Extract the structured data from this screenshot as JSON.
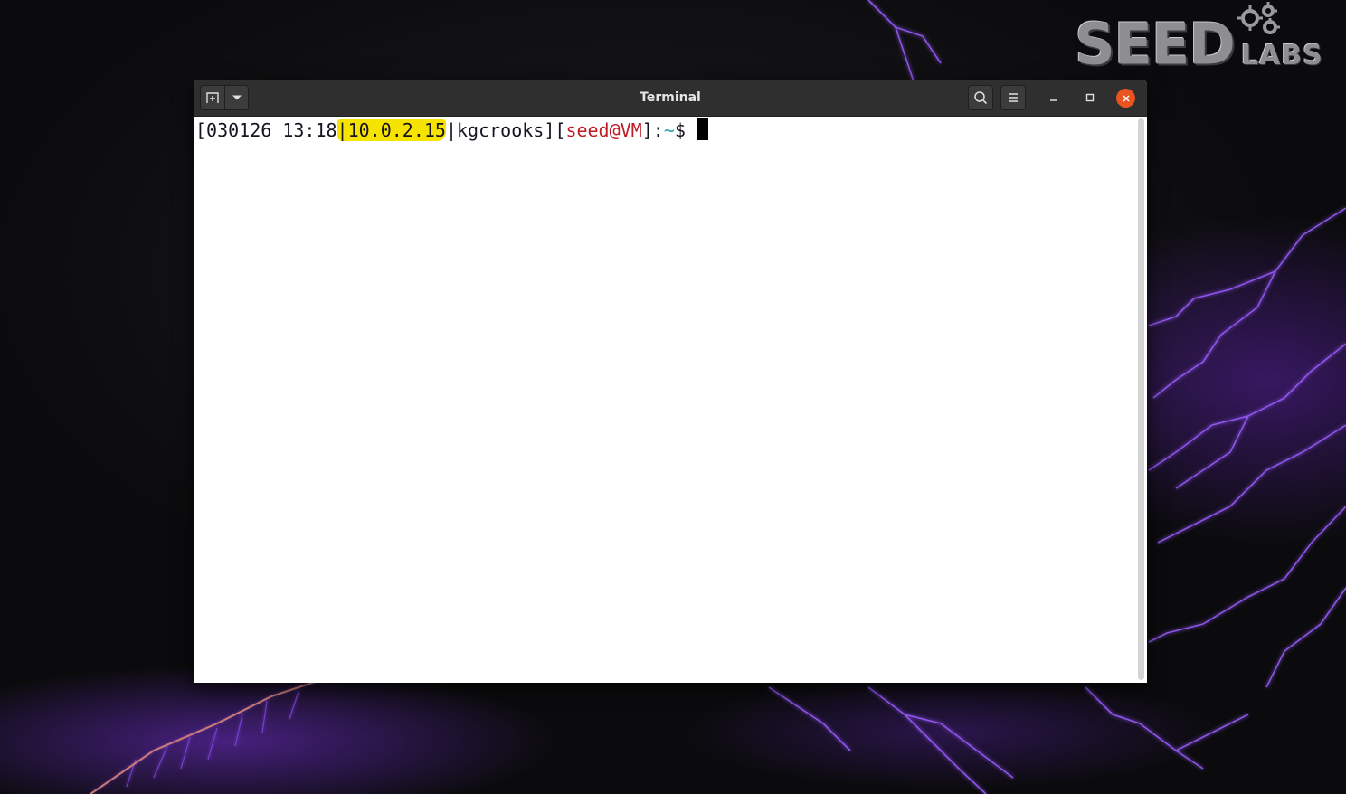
{
  "window": {
    "title": "Terminal"
  },
  "logo": {
    "word_main": "SEED",
    "word_sub": "LABS"
  },
  "terminal": {
    "prompt": {
      "open_bracket": "[",
      "date": "030126 13:18",
      "sep1": "|",
      "ip": "10.0.2.15",
      "sep2": "|",
      "user_label": "kgcrooks",
      "mid": "][",
      "user_host": "seed@VM",
      "close_colon": "]:",
      "path": "~",
      "symbol": "$"
    }
  },
  "icons": {
    "new_tab": "new-tab-icon",
    "tab_menu": "chevron-down-icon",
    "search": "search-icon",
    "menu": "hamburger-menu-icon",
    "minimize": "minimize-icon",
    "maximize": "maximize-icon",
    "close": "close-icon"
  },
  "colors": {
    "titlebar": "#2f2f2f",
    "close_button": "#e95420",
    "highlight": "#f7e300",
    "prompt_red": "#c01c28",
    "prompt_cyan": "#2aa1b3"
  }
}
